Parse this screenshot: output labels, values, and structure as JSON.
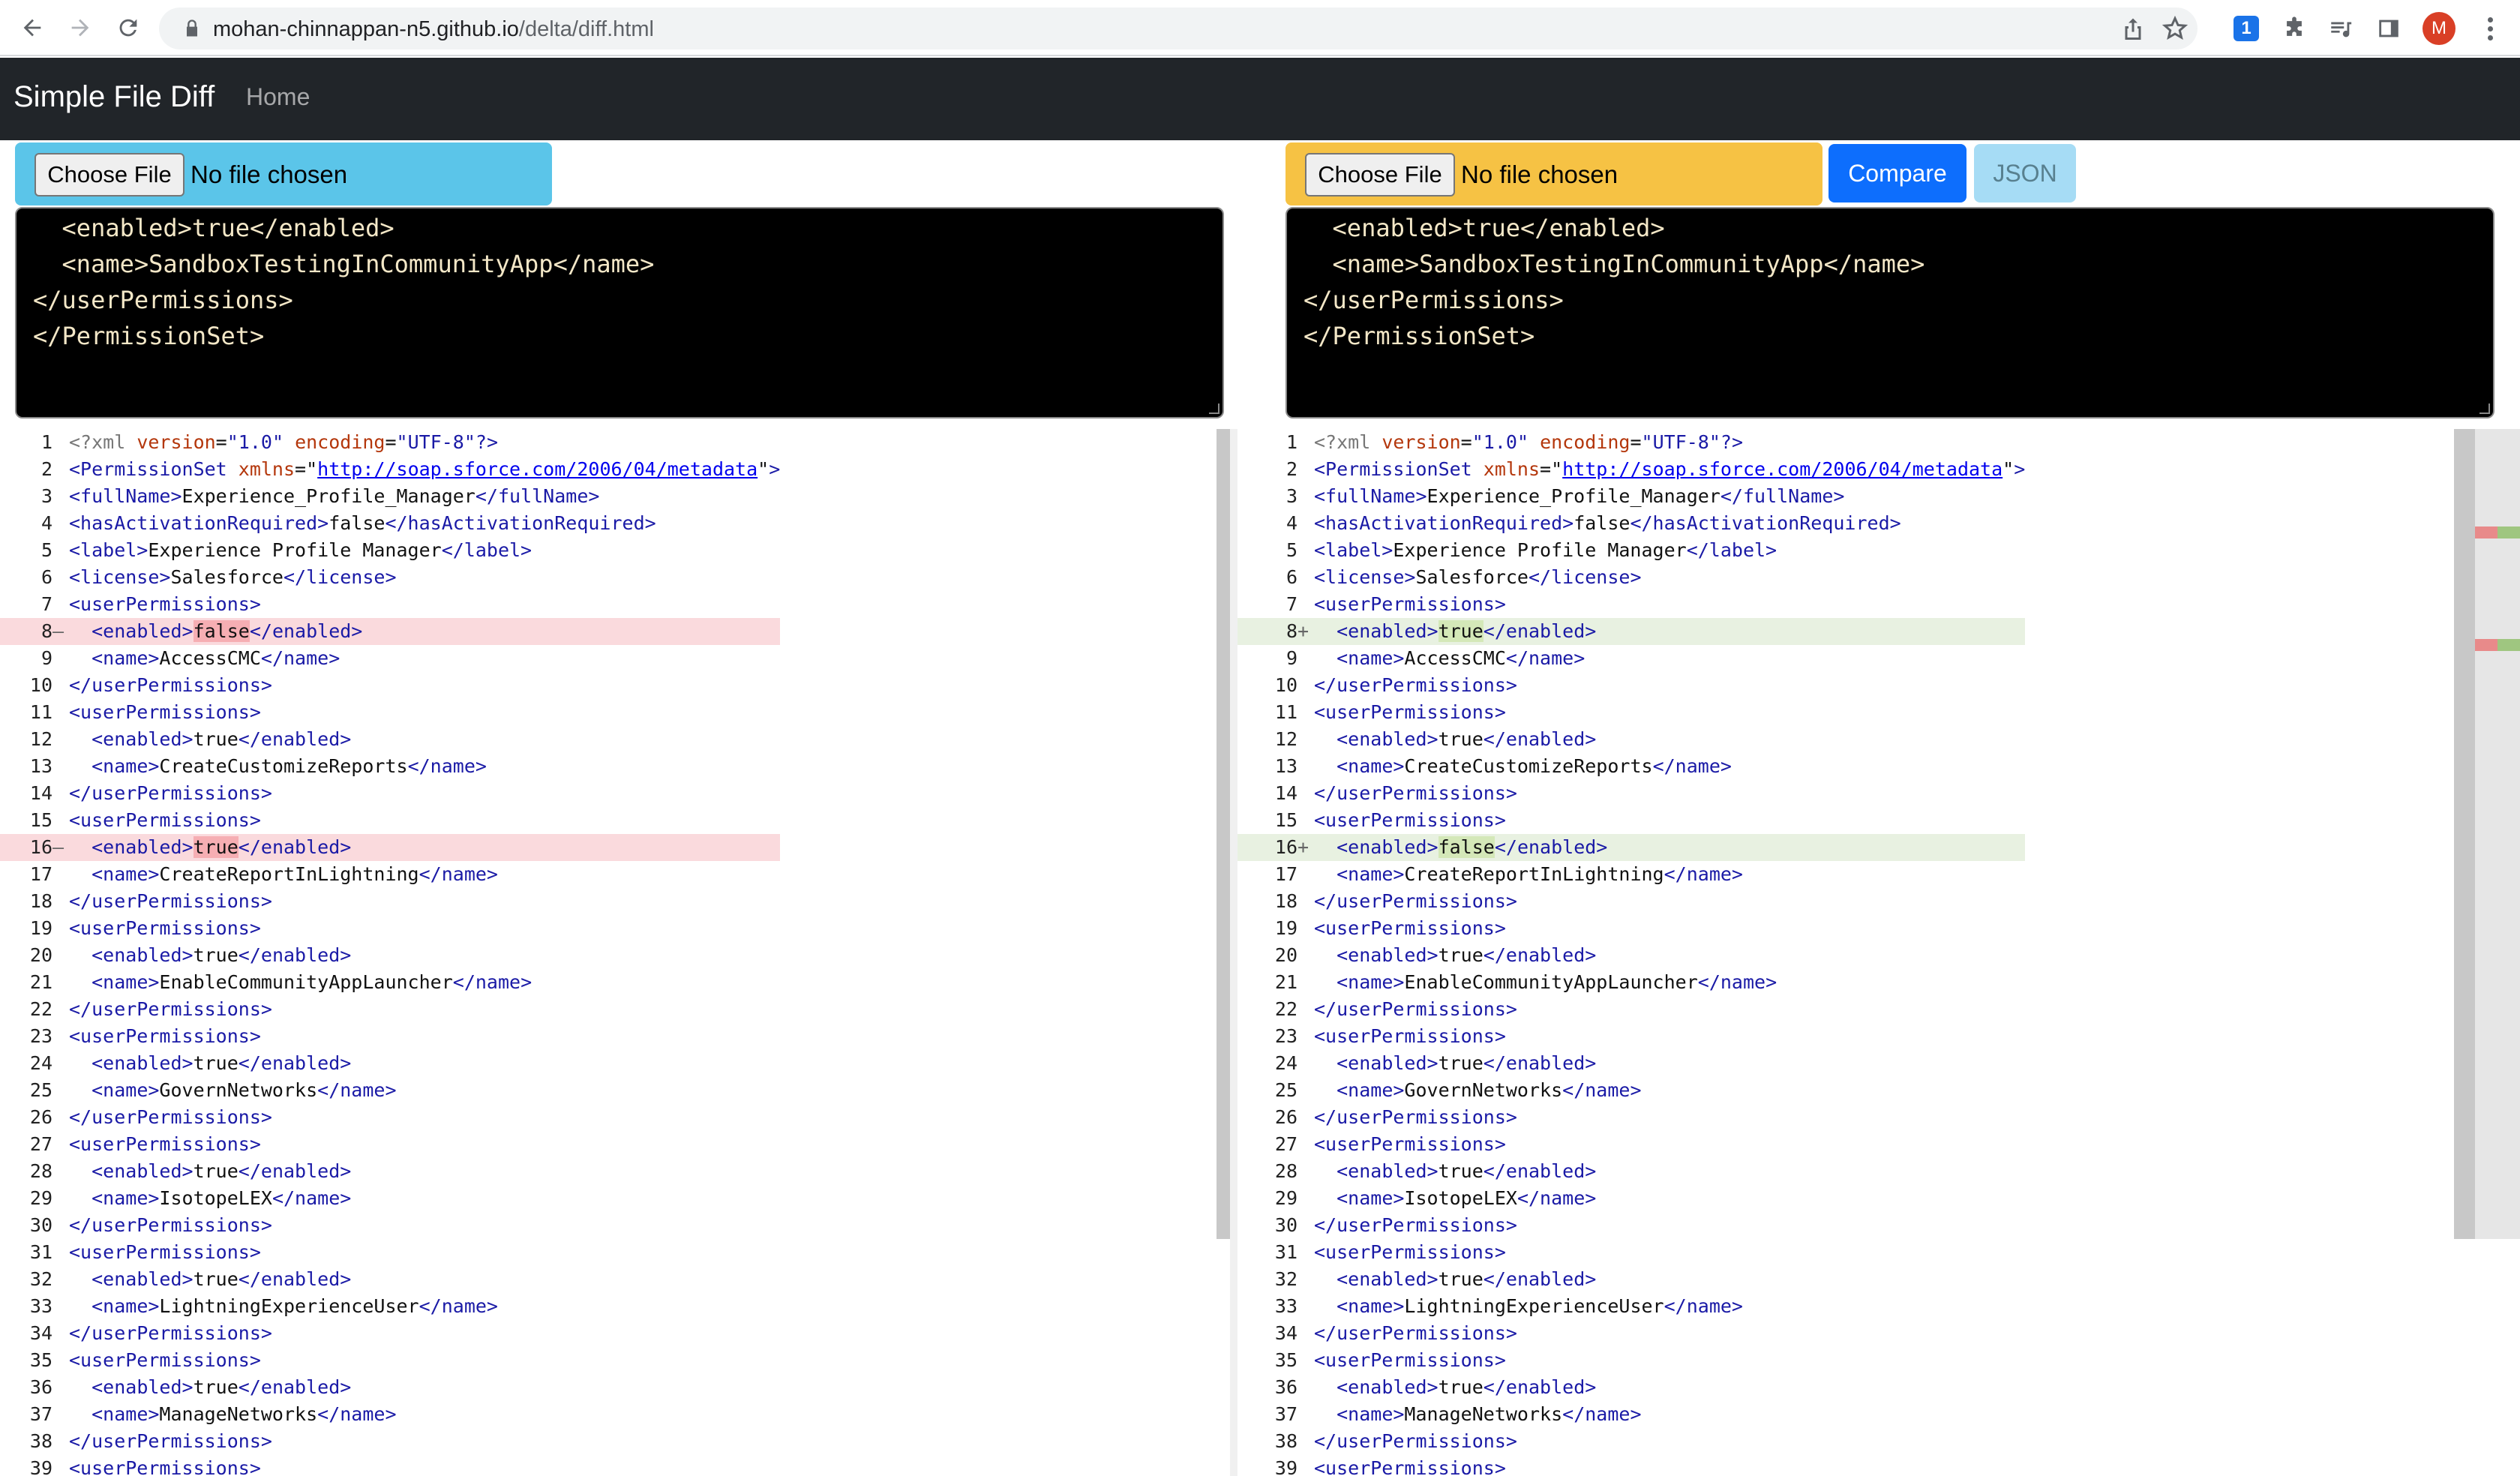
{
  "browser": {
    "url_host": "mohan-chinnappan-n5.github.io",
    "url_path": "/delta/diff.html",
    "avatar_letter": "M",
    "ext_1password_label": "1"
  },
  "navbar": {
    "brand": "Simple File Diff",
    "home": "Home"
  },
  "file_inputs": {
    "left": {
      "button": "Choose File",
      "status": "No file chosen"
    },
    "right": {
      "button": "Choose File",
      "status": "No file chosen"
    }
  },
  "actions": {
    "compare": "Compare",
    "json": "JSON"
  },
  "editors": {
    "left_text": "  <enabled>true</enabled>\n  <name>SandboxTestingInCommunityApp</name>\n</userPermissions>\n</PermissionSet>",
    "right_text": "  <enabled>true</enabled>\n  <name>SandboxTestingInCommunityApp</name>\n</userPermissions>\n</PermissionSet>"
  },
  "diff": {
    "url": "http://soap.sforce.com/2006/04/metadata",
    "left": [
      {
        "n": "1",
        "mk": "",
        "k": "xml"
      },
      {
        "n": "2",
        "mk": "",
        "k": "permset"
      },
      {
        "n": "3",
        "mk": "",
        "k": "el",
        "tag": "fullName",
        "val": "Experience_Profile_Manager",
        "ind": 0
      },
      {
        "n": "4",
        "mk": "",
        "k": "el",
        "tag": "hasActivationRequired",
        "val": "false",
        "ind": 0
      },
      {
        "n": "5",
        "mk": "",
        "k": "el",
        "tag": "label",
        "val": "Experience Profile Manager",
        "ind": 0
      },
      {
        "n": "6",
        "mk": "",
        "k": "el",
        "tag": "license",
        "val": "Salesforce",
        "ind": 0
      },
      {
        "n": "7",
        "mk": "",
        "k": "open",
        "tag": "userPermissions"
      },
      {
        "n": "8",
        "mk": "—",
        "k": "el",
        "tag": "enabled",
        "val": "false",
        "ind": 1,
        "state": "del"
      },
      {
        "n": "9",
        "mk": "",
        "k": "el",
        "tag": "name",
        "val": "AccessCMC",
        "ind": 1
      },
      {
        "n": "10",
        "mk": "",
        "k": "close",
        "tag": "userPermissions"
      },
      {
        "n": "11",
        "mk": "",
        "k": "open",
        "tag": "userPermissions"
      },
      {
        "n": "12",
        "mk": "",
        "k": "el",
        "tag": "enabled",
        "val": "true",
        "ind": 1
      },
      {
        "n": "13",
        "mk": "",
        "k": "el",
        "tag": "name",
        "val": "CreateCustomizeReports",
        "ind": 1
      },
      {
        "n": "14",
        "mk": "",
        "k": "close",
        "tag": "userPermissions"
      },
      {
        "n": "15",
        "mk": "",
        "k": "open",
        "tag": "userPermissions"
      },
      {
        "n": "16",
        "mk": "—",
        "k": "el",
        "tag": "enabled",
        "val": "true",
        "ind": 1,
        "state": "del"
      },
      {
        "n": "17",
        "mk": "",
        "k": "el",
        "tag": "name",
        "val": "CreateReportInLightning",
        "ind": 1
      },
      {
        "n": "18",
        "mk": "",
        "k": "close",
        "tag": "userPermissions"
      },
      {
        "n": "19",
        "mk": "",
        "k": "open",
        "tag": "userPermissions"
      },
      {
        "n": "20",
        "mk": "",
        "k": "el",
        "tag": "enabled",
        "val": "true",
        "ind": 1
      },
      {
        "n": "21",
        "mk": "",
        "k": "el",
        "tag": "name",
        "val": "EnableCommunityAppLauncher",
        "ind": 1
      },
      {
        "n": "22",
        "mk": "",
        "k": "close",
        "tag": "userPermissions"
      },
      {
        "n": "23",
        "mk": "",
        "k": "open",
        "tag": "userPermissions"
      },
      {
        "n": "24",
        "mk": "",
        "k": "el",
        "tag": "enabled",
        "val": "true",
        "ind": 1
      },
      {
        "n": "25",
        "mk": "",
        "k": "el",
        "tag": "name",
        "val": "GovernNetworks",
        "ind": 1
      },
      {
        "n": "26",
        "mk": "",
        "k": "close",
        "tag": "userPermissions"
      },
      {
        "n": "27",
        "mk": "",
        "k": "open",
        "tag": "userPermissions"
      },
      {
        "n": "28",
        "mk": "",
        "k": "el",
        "tag": "enabled",
        "val": "true",
        "ind": 1
      },
      {
        "n": "29",
        "mk": "",
        "k": "el",
        "tag": "name",
        "val": "IsotopeLEX",
        "ind": 1
      },
      {
        "n": "30",
        "mk": "",
        "k": "close",
        "tag": "userPermissions"
      },
      {
        "n": "31",
        "mk": "",
        "k": "open",
        "tag": "userPermissions"
      },
      {
        "n": "32",
        "mk": "",
        "k": "el",
        "tag": "enabled",
        "val": "true",
        "ind": 1
      },
      {
        "n": "33",
        "mk": "",
        "k": "el",
        "tag": "name",
        "val": "LightningExperienceUser",
        "ind": 1
      },
      {
        "n": "34",
        "mk": "",
        "k": "close",
        "tag": "userPermissions"
      },
      {
        "n": "35",
        "mk": "",
        "k": "open",
        "tag": "userPermissions"
      },
      {
        "n": "36",
        "mk": "",
        "k": "el",
        "tag": "enabled",
        "val": "true",
        "ind": 1
      },
      {
        "n": "37",
        "mk": "",
        "k": "el",
        "tag": "name",
        "val": "ManageNetworks",
        "ind": 1
      },
      {
        "n": "38",
        "mk": "",
        "k": "close",
        "tag": "userPermissions"
      },
      {
        "n": "39",
        "mk": "",
        "k": "open",
        "tag": "userPermissions"
      }
    ],
    "right": [
      {
        "n": "1",
        "mk": "",
        "k": "xml"
      },
      {
        "n": "2",
        "mk": "",
        "k": "permset"
      },
      {
        "n": "3",
        "mk": "",
        "k": "el",
        "tag": "fullName",
        "val": "Experience_Profile_Manager",
        "ind": 0
      },
      {
        "n": "4",
        "mk": "",
        "k": "el",
        "tag": "hasActivationRequired",
        "val": "false",
        "ind": 0
      },
      {
        "n": "5",
        "mk": "",
        "k": "el",
        "tag": "label",
        "val": "Experience Profile Manager",
        "ind": 0
      },
      {
        "n": "6",
        "mk": "",
        "k": "el",
        "tag": "license",
        "val": "Salesforce",
        "ind": 0
      },
      {
        "n": "7",
        "mk": "",
        "k": "open",
        "tag": "userPermissions"
      },
      {
        "n": "8",
        "mk": "+",
        "k": "el",
        "tag": "enabled",
        "val": "true",
        "ind": 1,
        "state": "add"
      },
      {
        "n": "9",
        "mk": "",
        "k": "el",
        "tag": "name",
        "val": "AccessCMC",
        "ind": 1
      },
      {
        "n": "10",
        "mk": "",
        "k": "close",
        "tag": "userPermissions"
      },
      {
        "n": "11",
        "mk": "",
        "k": "open",
        "tag": "userPermissions"
      },
      {
        "n": "12",
        "mk": "",
        "k": "el",
        "tag": "enabled",
        "val": "true",
        "ind": 1
      },
      {
        "n": "13",
        "mk": "",
        "k": "el",
        "tag": "name",
        "val": "CreateCustomizeReports",
        "ind": 1
      },
      {
        "n": "14",
        "mk": "",
        "k": "close",
        "tag": "userPermissions"
      },
      {
        "n": "15",
        "mk": "",
        "k": "open",
        "tag": "userPermissions"
      },
      {
        "n": "16",
        "mk": "+",
        "k": "el",
        "tag": "enabled",
        "val": "false",
        "ind": 1,
        "state": "add"
      },
      {
        "n": "17",
        "mk": "",
        "k": "el",
        "tag": "name",
        "val": "CreateReportInLightning",
        "ind": 1
      },
      {
        "n": "18",
        "mk": "",
        "k": "close",
        "tag": "userPermissions"
      },
      {
        "n": "19",
        "mk": "",
        "k": "open",
        "tag": "userPermissions"
      },
      {
        "n": "20",
        "mk": "",
        "k": "el",
        "tag": "enabled",
        "val": "true",
        "ind": 1
      },
      {
        "n": "21",
        "mk": "",
        "k": "el",
        "tag": "name",
        "val": "EnableCommunityAppLauncher",
        "ind": 1
      },
      {
        "n": "22",
        "mk": "",
        "k": "close",
        "tag": "userPermissions"
      },
      {
        "n": "23",
        "mk": "",
        "k": "open",
        "tag": "userPermissions"
      },
      {
        "n": "24",
        "mk": "",
        "k": "el",
        "tag": "enabled",
        "val": "true",
        "ind": 1
      },
      {
        "n": "25",
        "mk": "",
        "k": "el",
        "tag": "name",
        "val": "GovernNetworks",
        "ind": 1
      },
      {
        "n": "26",
        "mk": "",
        "k": "close",
        "tag": "userPermissions"
      },
      {
        "n": "27",
        "mk": "",
        "k": "open",
        "tag": "userPermissions"
      },
      {
        "n": "28",
        "mk": "",
        "k": "el",
        "tag": "enabled",
        "val": "true",
        "ind": 1
      },
      {
        "n": "29",
        "mk": "",
        "k": "el",
        "tag": "name",
        "val": "IsotopeLEX",
        "ind": 1
      },
      {
        "n": "30",
        "mk": "",
        "k": "close",
        "tag": "userPermissions"
      },
      {
        "n": "31",
        "mk": "",
        "k": "open",
        "tag": "userPermissions"
      },
      {
        "n": "32",
        "mk": "",
        "k": "el",
        "tag": "enabled",
        "val": "true",
        "ind": 1
      },
      {
        "n": "33",
        "mk": "",
        "k": "el",
        "tag": "name",
        "val": "LightningExperienceUser",
        "ind": 1
      },
      {
        "n": "34",
        "mk": "",
        "k": "close",
        "tag": "userPermissions"
      },
      {
        "n": "35",
        "mk": "",
        "k": "open",
        "tag": "userPermissions"
      },
      {
        "n": "36",
        "mk": "",
        "k": "el",
        "tag": "enabled",
        "val": "true",
        "ind": 1
      },
      {
        "n": "37",
        "mk": "",
        "k": "el",
        "tag": "name",
        "val": "ManageNetworks",
        "ind": 1
      },
      {
        "n": "38",
        "mk": "",
        "k": "close",
        "tag": "userPermissions"
      },
      {
        "n": "39",
        "mk": "",
        "k": "open",
        "tag": "userPermissions"
      }
    ]
  },
  "colors": {
    "navbar": "#212529",
    "left_filebar": "#5bc5e9",
    "right_filebar": "#f6c244",
    "compare": "#0d6efd",
    "deleted_line": "#fadadd",
    "added_line": "#e8f1e1"
  }
}
